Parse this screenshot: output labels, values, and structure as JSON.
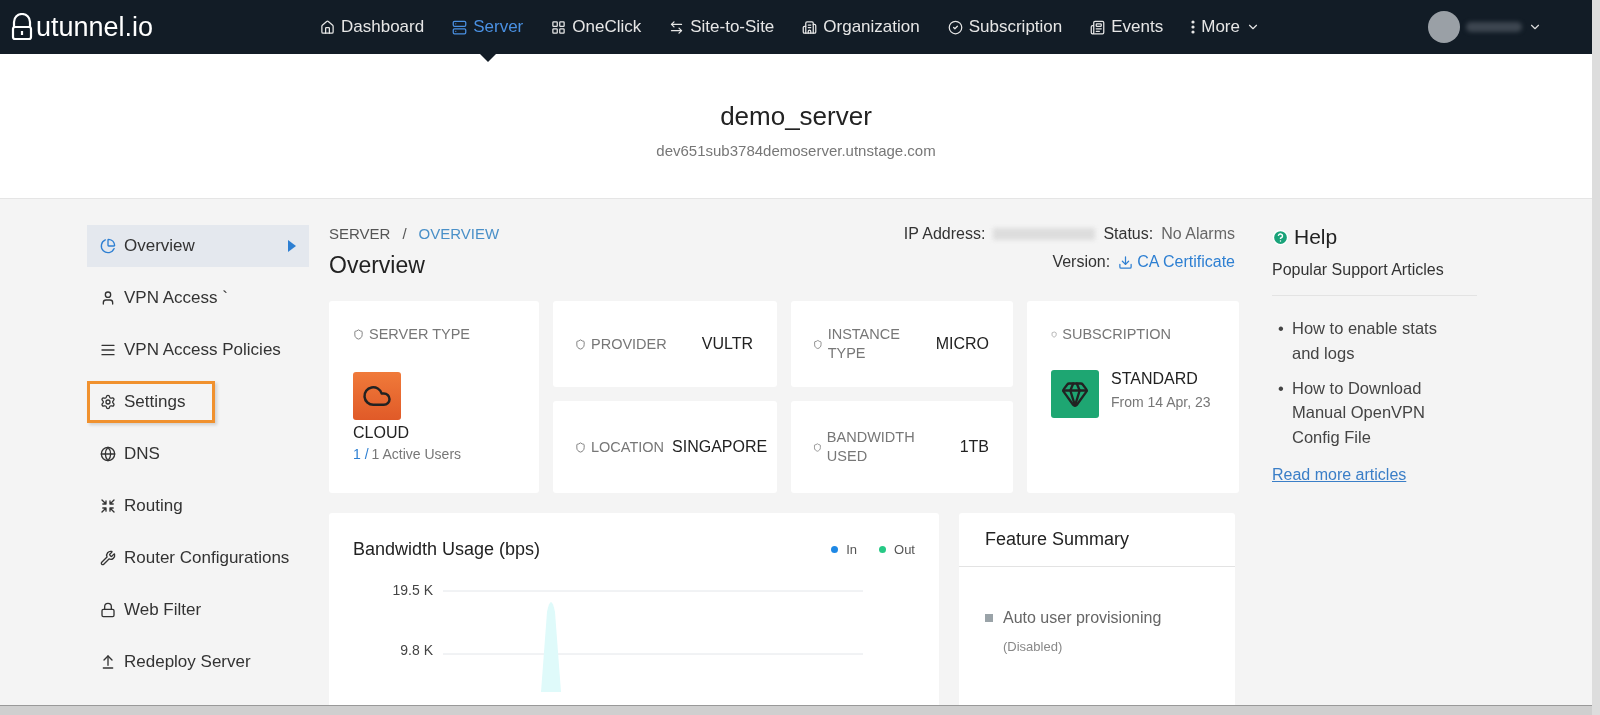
{
  "brand": {
    "name": "utunnel.io"
  },
  "nav": [
    {
      "label": "Dashboard",
      "selected": false
    },
    {
      "label": "Server",
      "selected": true
    },
    {
      "label": "OneClick",
      "selected": false
    },
    {
      "label": "Site-to-Site",
      "selected": false
    },
    {
      "label": "Organization",
      "selected": false
    },
    {
      "label": "Subscription",
      "selected": false
    },
    {
      "label": "Events",
      "selected": false
    },
    {
      "label": "More",
      "selected": false,
      "dropdown": true
    }
  ],
  "header": {
    "title": "demo_server",
    "subtitle": "dev651sub3784demoserver.utnstage.com"
  },
  "sidebar": {
    "items": [
      {
        "label": "Overview",
        "selected": true,
        "highlighted": false
      },
      {
        "label": "VPN Access `",
        "selected": false,
        "highlighted": false
      },
      {
        "label": "VPN Access Policies",
        "selected": false,
        "highlighted": false
      },
      {
        "label": "Settings",
        "selected": false,
        "highlighted": true
      },
      {
        "label": "DNS",
        "selected": false,
        "highlighted": false
      },
      {
        "label": "Routing",
        "selected": false,
        "highlighted": false
      },
      {
        "label": "Router Configurations",
        "selected": false,
        "highlighted": false
      },
      {
        "label": "Web Filter",
        "selected": false,
        "highlighted": false
      },
      {
        "label": "Redeploy Server",
        "selected": false,
        "highlighted": false
      }
    ]
  },
  "breadcrumb": [
    {
      "label": "SERVER",
      "selected": false
    },
    {
      "label": "OVERVIEW",
      "selected": true
    }
  ],
  "breadcrumb_separator": "/",
  "page_title": "Overview",
  "info": {
    "ip_label": "IP Address:",
    "status_label": "Status:",
    "status_value": "No Alarms",
    "version_label": "Version:",
    "certificate_link": "CA Certificate"
  },
  "server_type": {
    "label": "SERVER TYPE",
    "value": "CLOUD",
    "users_count": "1 /",
    "users_text": "1 Active Users"
  },
  "stats": [
    {
      "label": "PROVIDER",
      "value": "VULTR"
    },
    {
      "label": "INSTANCE TYPE",
      "value": "MICRO"
    },
    {
      "label": "LOCATION",
      "value": "SINGAPORE"
    },
    {
      "label": "BANDWIDTH USED",
      "value": "1TB"
    }
  ],
  "subscription": {
    "label": "SUBSCRIPTION",
    "plan": "STANDARD",
    "since": "From 14 Apr, 23"
  },
  "bandwidth": {
    "title": "Bandwidth Usage (bps)",
    "legend": [
      {
        "name": "In",
        "color": "#1e88e5"
      },
      {
        "name": "Out",
        "color": "#26c985"
      }
    ],
    "tick_labels": [
      "19.5 K",
      "9.8 K"
    ]
  },
  "feature_summary": {
    "title": "Feature Summary",
    "items": [
      {
        "name": "Auto user provisioning",
        "state": "(Disabled)"
      }
    ]
  },
  "help": {
    "title": "Help",
    "subtitle": "Popular Support Articles",
    "bullet": "•",
    "articles": [
      "How to enable stats and logs",
      "How to Download Manual OpenVPN Config File"
    ],
    "more_link": "Read more articles"
  }
}
